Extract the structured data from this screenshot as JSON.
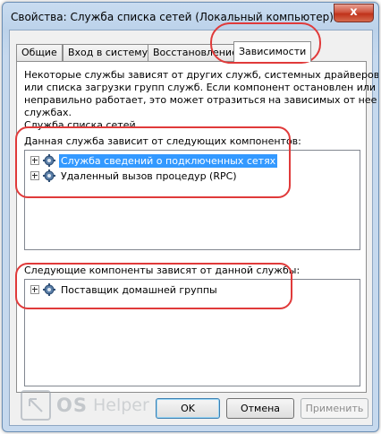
{
  "window": {
    "title": "Свойства: Служба списка сетей (Локальный компьютер)",
    "close_glyph": "x"
  },
  "tabs": [
    {
      "label": "Общие"
    },
    {
      "label": "Вход в систему"
    },
    {
      "label": "Восстановление"
    },
    {
      "label": "Зависимости",
      "active": true
    }
  ],
  "panel": {
    "description": [
      "Некоторые службы зависят от других служб, системных драйверов",
      "или списка загрузки групп служб. Если компонент остановлен или",
      "неправильно работает, это может отразиться на зависимых от нее",
      "службах."
    ],
    "service_name": "Служба списка сетей",
    "depends_on": {
      "label": "Данная служба зависит от следующих компонентов:",
      "items": [
        {
          "text": "Служба сведений о подключенных сетях",
          "selected": true
        },
        {
          "text": "Удаленный вызов процедур (RPC)",
          "selected": false
        }
      ]
    },
    "dependents": {
      "label": "Следующие компоненты зависят от данной службы:",
      "items": [
        {
          "text": "Поставщик домашней группы",
          "selected": false
        }
      ]
    }
  },
  "buttons": {
    "ok": "OK",
    "cancel": "Отмена",
    "apply": "Применить"
  },
  "watermark": {
    "text_os": "OS",
    "text_helper": "Helper"
  },
  "colors": {
    "selection": "#3399ff",
    "annotation": "#e03a3a"
  }
}
